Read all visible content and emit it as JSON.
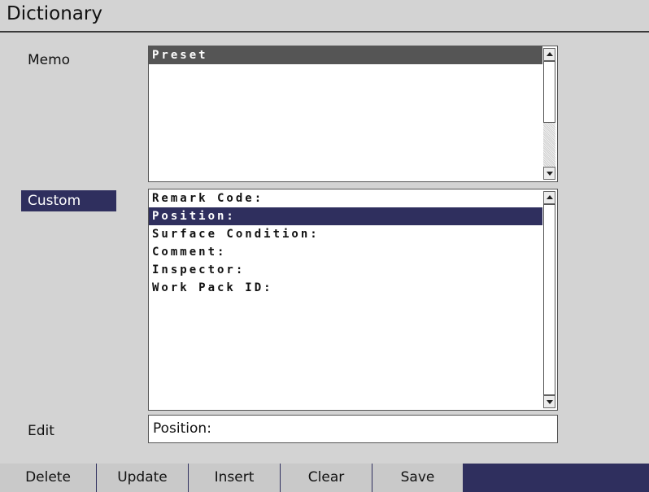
{
  "window": {
    "title": "Dictionary"
  },
  "memo": {
    "label": "Memo",
    "items": [
      "Preset"
    ]
  },
  "custom": {
    "label": "Custom",
    "items": [
      "Remark Code:",
      "Position:",
      "Surface Condition:",
      "Comment:",
      "Inspector:",
      "Work Pack ID:"
    ],
    "selected_item": "Position:"
  },
  "edit": {
    "label": "Edit",
    "value": "Position:"
  },
  "softkeys": [
    "Delete",
    "Update",
    "Insert",
    "Clear",
    "Save"
  ],
  "colors": {
    "selection": "#2f2f5e",
    "list_header": "#555555",
    "background": "#d3d3d3"
  },
  "icons": {
    "scroll_up": "chevron-up-icon",
    "scroll_down": "chevron-down-icon"
  }
}
